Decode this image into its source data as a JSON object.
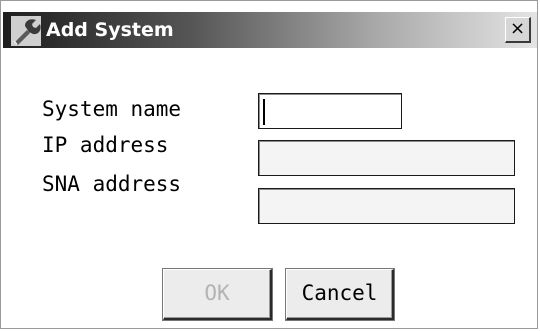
{
  "window": {
    "title": "Add System",
    "close_glyph": "×",
    "icon": "wrench-tool-icon"
  },
  "form": {
    "system_name": {
      "label": "System name",
      "value": ""
    },
    "ip_address": {
      "label": "IP address",
      "value": ""
    },
    "sna_address": {
      "label": "SNA address",
      "value": ""
    }
  },
  "buttons": {
    "ok": "OK",
    "ok_enabled": false,
    "cancel": "Cancel"
  },
  "colors": {
    "titlebar_start": "#1e1e1e",
    "titlebar_end": "#e4e4e4",
    "title_text": "#ffffff",
    "disabled_text": "#b3b3b3"
  }
}
